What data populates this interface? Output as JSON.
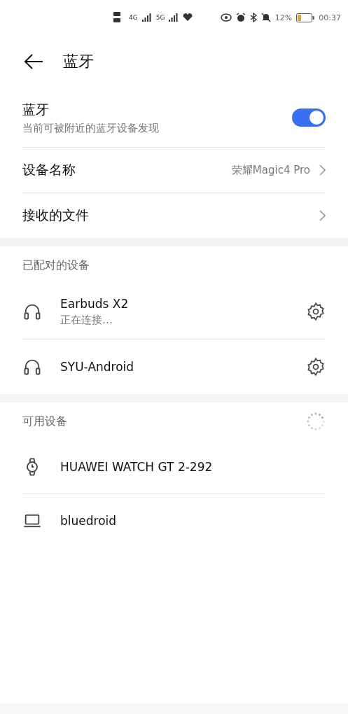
{
  "status_bar": {
    "network_1": "4G",
    "network_2": "5G",
    "battery_percent": "12%",
    "time": "00:37"
  },
  "header": {
    "title": "蓝牙"
  },
  "bluetooth": {
    "label": "蓝牙",
    "description": "当前可被附近的蓝牙设备发现",
    "on": true
  },
  "settings": [
    {
      "label": "设备名称",
      "value": "荣耀Magic4 Pro"
    },
    {
      "label": "接收的文件"
    }
  ],
  "paired": {
    "title": "已配对的设备",
    "devices": [
      {
        "kind": "headphones",
        "name": "Earbuds X2",
        "status": "正在连接…"
      },
      {
        "kind": "headphones",
        "name": "SYU-Android"
      }
    ]
  },
  "available": {
    "title": "可用设备",
    "scanning": true,
    "devices": [
      {
        "kind": "watch",
        "name": "HUAWEI WATCH GT 2-292"
      },
      {
        "kind": "laptop",
        "name": "bluedroid"
      }
    ]
  }
}
